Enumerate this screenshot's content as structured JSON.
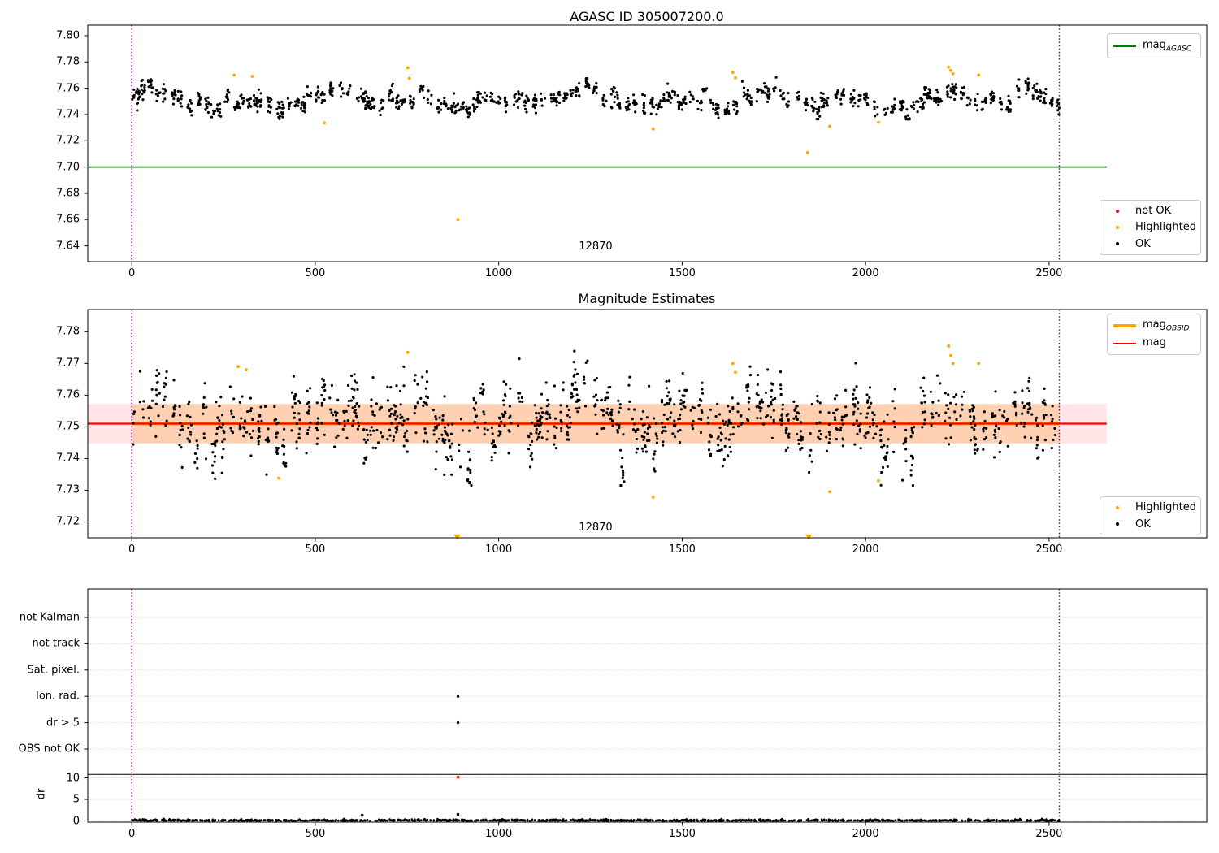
{
  "colors": {
    "ok_marker": "#000000",
    "not_ok_marker": "#ff0000",
    "highlighted_marker": "#ffa500",
    "mag_agasc_line": "#008000",
    "mag_line": "#ff0000",
    "mag_obsid_line": "#ffa500",
    "obsid_boundary_line": "#800080",
    "mag_err_band": "rgba(255,0,0,0.10)",
    "obsid_band": "rgba(255,140,0,0.22)",
    "grid": "#c9c9c9",
    "axis": "#000000"
  },
  "chart_data": [
    {
      "type": "scatter",
      "title": "AGASC ID 305007200.0",
      "xlim": [
        -120,
        2930
      ],
      "ylim": [
        7.628,
        7.808
      ],
      "xtick_values": [
        0,
        500,
        1000,
        1500,
        2000,
        2500
      ],
      "xtick_labels": [
        "0",
        "500",
        "1000",
        "1500",
        "2000",
        "2500"
      ],
      "ytick_values": [
        7.64,
        7.66,
        7.68,
        7.7,
        7.72,
        7.74,
        7.76,
        7.78,
        7.8
      ],
      "ytick_labels": [
        "7.64",
        "7.66",
        "7.68",
        "7.70",
        "7.72",
        "7.74",
        "7.76",
        "7.78",
        "7.80"
      ],
      "annotation": {
        "text": "12870",
        "x": 1264,
        "y": 7.638
      },
      "mag_agasc": 7.7,
      "agasc_line_span": [
        -120,
        2657
      ],
      "obsid_boundaries": [
        0,
        2528
      ],
      "scatter_band": {
        "n": 1000,
        "mean": 7.7512,
        "cluster_noise": 0.0028,
        "point_noise": 0.0033,
        "clip": [
          7.7365,
          7.7705
        ],
        "x_range": [
          2,
          2526
        ]
      },
      "highlighted": [
        [
          279,
          7.77
        ],
        [
          328,
          7.769
        ],
        [
          525,
          7.7336
        ],
        [
          752,
          7.7755
        ],
        [
          756,
          7.7675
        ],
        [
          889,
          7.66
        ],
        [
          1421,
          7.729
        ],
        [
          1638,
          7.772
        ],
        [
          1645,
          7.768
        ],
        [
          1842,
          7.711
        ],
        [
          1902,
          7.731
        ],
        [
          2035,
          7.734
        ],
        [
          2226,
          7.776
        ],
        [
          2232,
          7.7735
        ],
        [
          2238,
          7.771
        ],
        [
          2308,
          7.77
        ]
      ],
      "legend_line": {
        "label_main": "mag",
        "label_sub": "AGASC"
      },
      "legend_markers": [
        {
          "label": "not OK",
          "color_key": "not_ok_marker"
        },
        {
          "label": "Highlighted",
          "color_key": "highlighted_marker"
        },
        {
          "label": "OK",
          "color_key": "ok_marker"
        }
      ]
    },
    {
      "type": "scatter",
      "title": "Magnitude Estimates",
      "xlim": [
        -120,
        2930
      ],
      "ylim": [
        7.715,
        7.787
      ],
      "xtick_values": [
        0,
        500,
        1000,
        1500,
        2000,
        2500
      ],
      "xtick_labels": [
        "0",
        "500",
        "1000",
        "1500",
        "2000",
        "2500"
      ],
      "ytick_values": [
        7.72,
        7.73,
        7.74,
        7.75,
        7.76,
        7.77,
        7.78
      ],
      "ytick_labels": [
        "7.72",
        "7.73",
        "7.74",
        "7.75",
        "7.76",
        "7.77",
        "7.78"
      ],
      "annotation": {
        "text": "12870",
        "x": 1264,
        "y": 7.717
      },
      "mag": 7.751,
      "mag_err_band": [
        7.7448,
        7.7572
      ],
      "mag_line_span": [
        -120,
        2657
      ],
      "obsid_band_span": [
        0,
        2528
      ],
      "obsid_boundaries": [
        0,
        2528
      ],
      "scatter_band": {
        "n": 1000,
        "mean": 7.7508,
        "cluster_noise": 0.0035,
        "point_noise": 0.0048,
        "clip": [
          7.7315,
          7.7755
        ],
        "x_range": [
          2,
          2526
        ]
      },
      "highlighted": [
        [
          290,
          7.769
        ],
        [
          312,
          7.768
        ],
        [
          400,
          7.7338
        ],
        [
          752,
          7.7735
        ],
        [
          1421,
          7.7278
        ],
        [
          1638,
          7.77
        ],
        [
          1645,
          7.7672
        ],
        [
          1902,
          7.7295
        ],
        [
          2035,
          7.733
        ],
        [
          2226,
          7.7755
        ],
        [
          2232,
          7.7725
        ],
        [
          2238,
          7.77
        ],
        [
          2308,
          7.77
        ]
      ],
      "clipped_low_markers": [
        [
          887,
          7.7153
        ],
        [
          1845,
          7.7153
        ]
      ],
      "legend_lines": [
        {
          "label_main": "mag",
          "label_sub": "OBSID",
          "color_key": "mag_obsid_line"
        },
        {
          "label_main": "mag",
          "label_sub": "",
          "color_key": "mag_line"
        }
      ],
      "legend_markers": [
        {
          "label": "Highlighted",
          "color_key": "highlighted_marker"
        },
        {
          "label": "OK",
          "color_key": "ok_marker"
        }
      ]
    },
    {
      "type": "flags",
      "categories": [
        "not Kalman",
        "not track",
        "Sat. pixel.",
        "Ion. rad.",
        "dr > 5",
        "OBS not OK"
      ],
      "dr_label": "dr",
      "dr_tick_values": [
        0,
        5,
        10
      ],
      "dr_tick_labels": [
        "0",
        "5",
        "10"
      ],
      "separator_dr": 10.8,
      "xtick_values": [
        0,
        500,
        1000,
        1500,
        2000,
        2500
      ],
      "xtick_labels": [
        "0",
        "500",
        "1000",
        "1500",
        "2000",
        "2500"
      ],
      "obsid_boundaries": [
        0,
        2528
      ],
      "flag_points": [
        {
          "x": 889,
          "flag": "Ion. rad.",
          "color_key": "ok_marker"
        },
        {
          "x": 889,
          "flag": "dr > 5",
          "color_key": "ok_marker"
        }
      ],
      "dr_points": [
        {
          "x": 889,
          "dr": 10.15,
          "color_key": "not_ok_marker"
        },
        {
          "x": 889,
          "dr": 1.5,
          "color_key": "ok_marker"
        },
        {
          "x": 628,
          "dr": 1.3,
          "color_key": "ok_marker"
        }
      ],
      "dr_band": {
        "n": 1100,
        "scale": 0.15,
        "offset": 0.03,
        "clip": 0.7,
        "x_range": [
          0,
          2528
        ]
      }
    }
  ]
}
